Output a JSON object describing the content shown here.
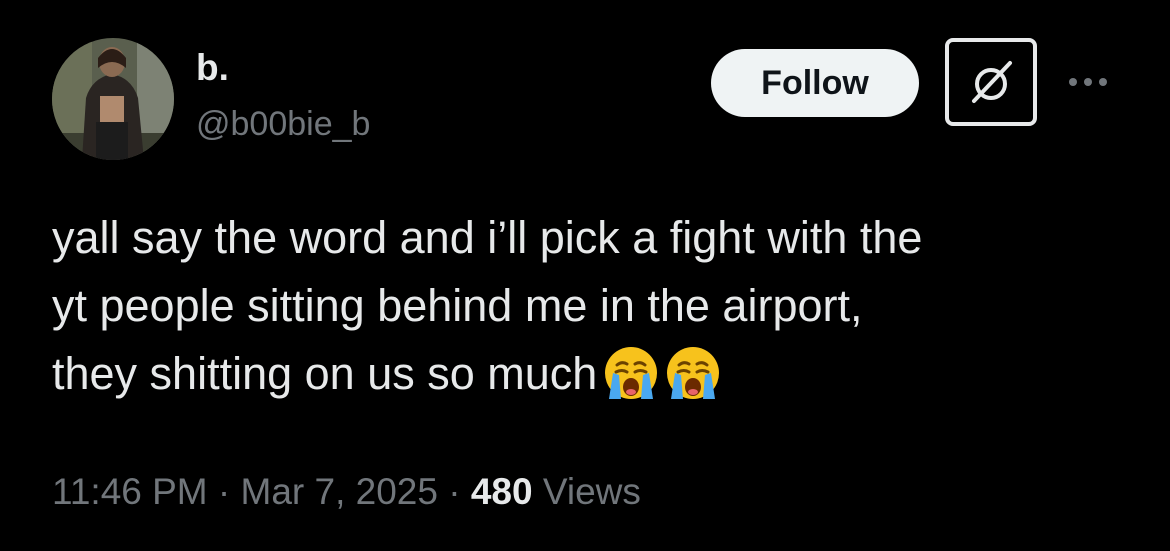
{
  "author": {
    "display_name": "b.",
    "handle": "@b00bie_b",
    "avatar_icon": "profile-photo"
  },
  "actions": {
    "follow_label": "Follow",
    "grok_icon": "grok-icon",
    "more_icon": "ellipsis-icon"
  },
  "tweet": {
    "lines": [
      "yall say the word and i’ll pick a fight with the",
      "yt people sitting behind me in the airport,",
      "they shitting on us so much"
    ],
    "emojis": [
      "loudly-crying-face",
      "loudly-crying-face"
    ]
  },
  "meta": {
    "time": "11:46 PM",
    "separator": "·",
    "date": "Mar 7, 2025",
    "views_count": "480",
    "views_label": "Views"
  },
  "colors": {
    "background": "#000000",
    "text_primary": "#e7e9ea",
    "text_secondary": "#71767b",
    "follow_bg": "#eff3f4"
  }
}
